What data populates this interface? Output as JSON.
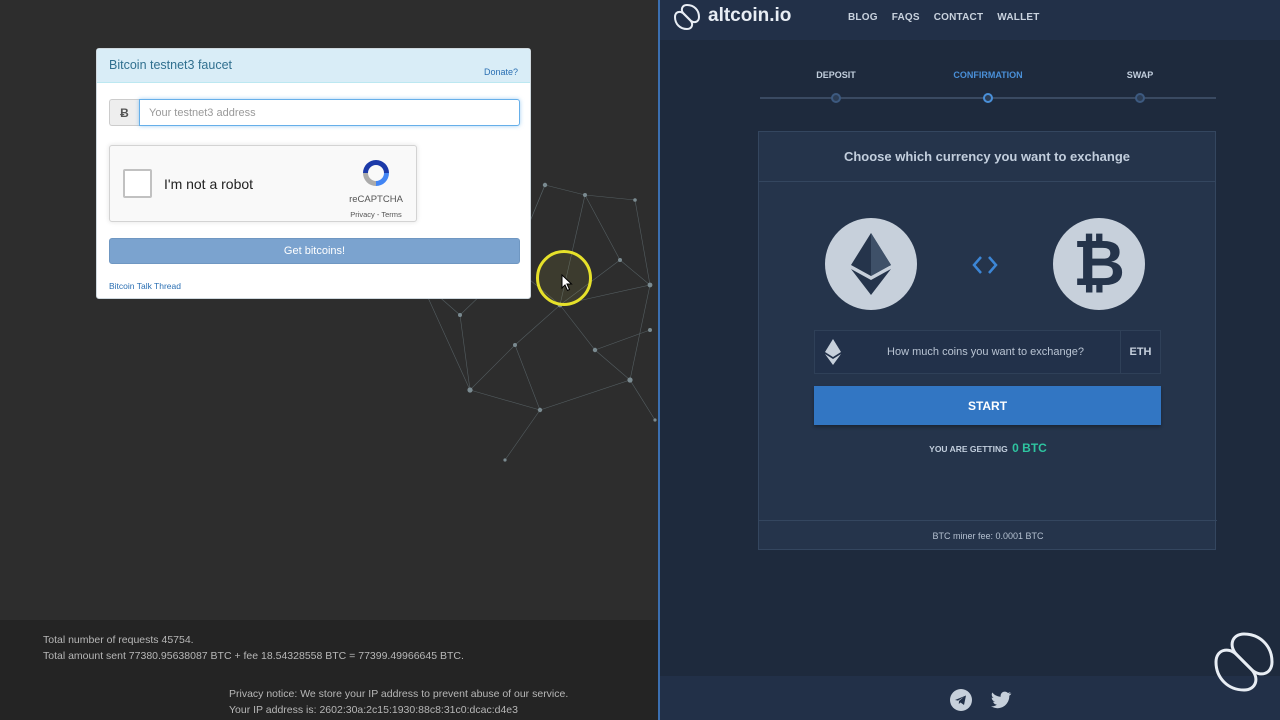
{
  "faucet": {
    "title": "Bitcoin testnet3 faucet",
    "donate": "Donate?",
    "addon": "Ƀ",
    "address_placeholder": "Your testnet3 address",
    "captcha_label": "I'm not a robot",
    "captcha_brand": "reCAPTCHA",
    "captcha_links": "Privacy - Terms",
    "submit_label": "Get bitcoins!",
    "thread_link": "Bitcoin Talk Thread"
  },
  "stats": {
    "requests": "Total number of requests 45754.",
    "amount": "Total amount sent 77380.95638087 BTC + fee 18.54328558 BTC = 77399.49966645 BTC.",
    "privacy": "Privacy notice: We store your IP address to prevent abuse of our service.",
    "ip": "Your IP address is: 2602:30a:2c15:1930:88c8:31c0:dcac:d4e3"
  },
  "altcoin": {
    "brand": "altcoin.io",
    "nav": [
      "BLOG",
      "FAQS",
      "CONTACT",
      "WALLET"
    ],
    "steps": [
      {
        "label": "DEPOSIT",
        "active": false
      },
      {
        "label": "CONFIRMATION",
        "active": true
      },
      {
        "label": "SWAP",
        "active": false
      }
    ],
    "card_title": "Choose which currency you want to exchange",
    "btc_glyph": "₿",
    "amount_placeholder": "How much coins you want to exchange?",
    "amount_unit": "ETH",
    "start_label": "START",
    "getting_label": "YOU ARE GETTING",
    "getting_value": "0 BTC",
    "miner_fee": "BTC miner fee: 0.0001 BTC"
  },
  "colors": {
    "accent": "#3276c3",
    "step_active": "#4a90d9",
    "step_inactive": "#c2cedd",
    "success": "#2ec4a0"
  }
}
